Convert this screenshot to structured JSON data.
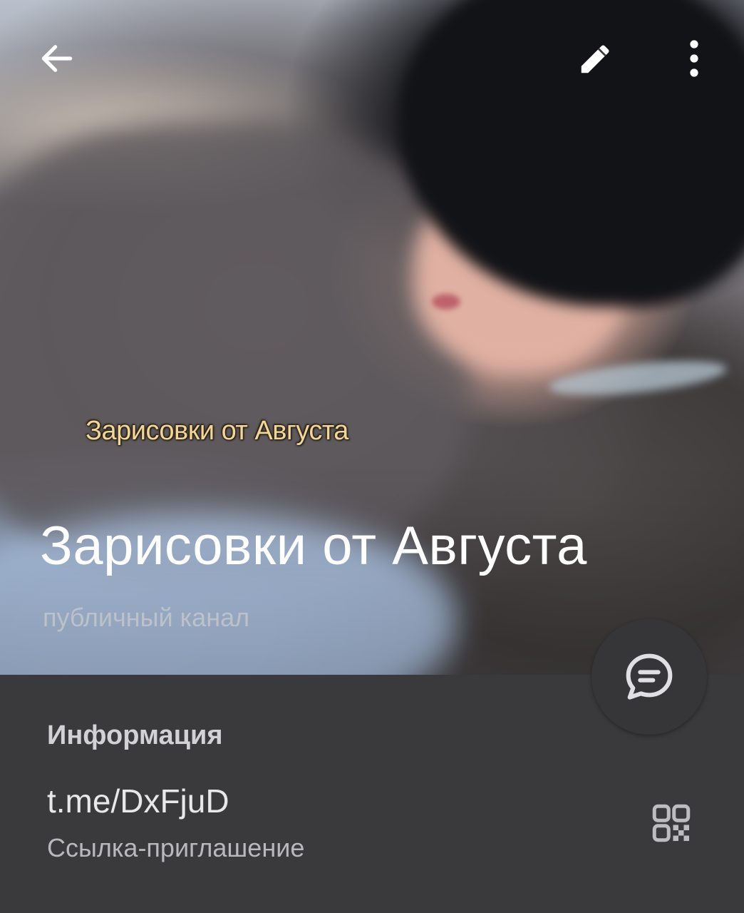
{
  "header": {
    "back_icon": "arrow-left-icon",
    "edit_icon": "pencil-icon",
    "more_icon": "vertical-dots-icon"
  },
  "photo": {
    "caption": "Зарисовки от Августа"
  },
  "channel": {
    "title": "Зарисовки от Августа",
    "subtitle": "публичный канал"
  },
  "fab": {
    "icon": "chat-bubble-icon"
  },
  "info": {
    "heading": "Информация",
    "link": "t.me/DxFjuD",
    "link_label": "Ссылка-приглашение",
    "qr_icon": "qr-code-icon"
  },
  "colors": {
    "background": "#3a393b",
    "fab": "#363537",
    "title": "#ffffff",
    "caption": "#f1d69a"
  }
}
